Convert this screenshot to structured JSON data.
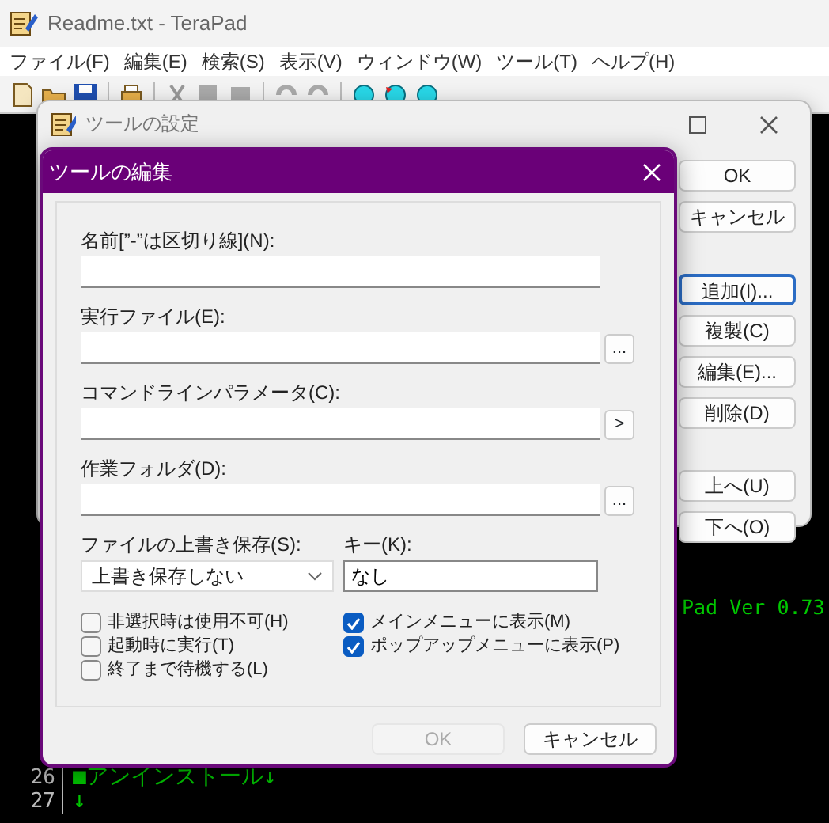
{
  "window": {
    "title": "Readme.txt - TeraPad"
  },
  "menu": [
    "ファイル(F)",
    "編集(E)",
    "検索(S)",
    "表示(V)",
    "ウィンドウ(W)",
    "ツール(T)",
    "ヘルプ(H)"
  ],
  "editor": {
    "fragment": "Pad Ver 0.73",
    "lines": [
      {
        "number": "26",
        "text": "■アンインストール↓"
      },
      {
        "number": "27",
        "text": "↓"
      }
    ]
  },
  "tool_settings": {
    "title": "ツールの設定",
    "buttons": [
      {
        "label": "OK",
        "focused": false
      },
      {
        "label": "キャンセル",
        "focused": false
      },
      {
        "label": "追加(I)...",
        "focused": true
      },
      {
        "label": "複製(C)",
        "focused": false
      },
      {
        "label": "編集(E)...",
        "focused": false
      },
      {
        "label": "削除(D)",
        "focused": false
      },
      {
        "label": "上へ(U)",
        "focused": false
      },
      {
        "label": "下へ(O)",
        "focused": false
      }
    ]
  },
  "edit_dialog": {
    "title": "ツールの編集",
    "fields": [
      {
        "label": "名前[”-”は区切り線](N):",
        "kind": "text"
      },
      {
        "label": "実行ファイル(E):",
        "kind": "button",
        "button": "..."
      },
      {
        "label": "コマンドラインパラメータ(C):",
        "kind": "button",
        "button": ">"
      },
      {
        "label": "作業フォルダ(D):",
        "kind": "button",
        "button": "..."
      }
    ],
    "overwrite": {
      "label": "ファイルの上書き保存(S):",
      "value": "上書き保存しない"
    },
    "key": {
      "label": "キー(K):",
      "value": "なし"
    },
    "checkboxes_left": [
      {
        "label": "非選択時は使用不可(H)",
        "checked": false
      },
      {
        "label": "起動時に実行(T)",
        "checked": false
      },
      {
        "label": "終了まで待機する(L)",
        "checked": false
      }
    ],
    "checkboxes_right": [
      {
        "label": "メインメニューに表示(M)",
        "checked": true
      },
      {
        "label": "ポップアップメニューに表示(P)",
        "checked": true
      }
    ],
    "buttons": [
      {
        "label": "OK",
        "disabled": true
      },
      {
        "label": "キャンセル",
        "disabled": false
      }
    ]
  }
}
